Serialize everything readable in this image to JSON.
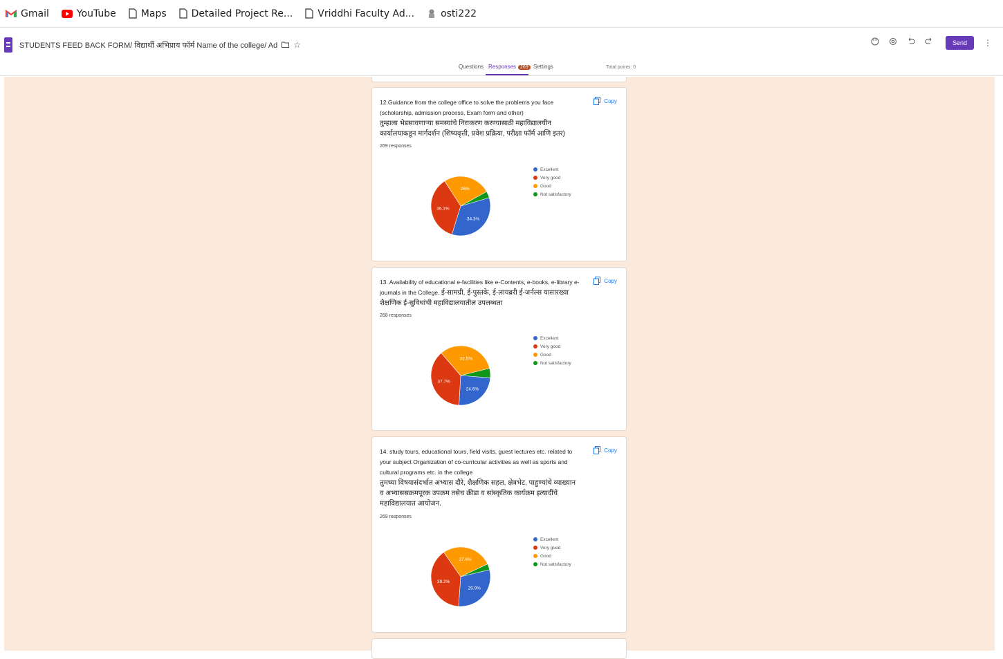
{
  "bookmarks": [
    {
      "label": "Gmail",
      "icon": "gmail-icon"
    },
    {
      "label": "YouTube",
      "icon": "youtube-icon"
    },
    {
      "label": "Maps",
      "icon": "page-icon"
    },
    {
      "label": "Detailed Project Re...",
      "icon": "page-icon"
    },
    {
      "label": "Vriddhi Faculty Ad...",
      "icon": "page-icon"
    },
    {
      "label": "osti222",
      "icon": "emblem-icon"
    }
  ],
  "header": {
    "title": "STUDENTS FEED BACK FORM/ विद्यार्थी अभिप्राय फॉर्म  Name of the college/ Ad",
    "send_label": "Send",
    "accent": "#673ab7"
  },
  "tabs": {
    "questions": "Questions",
    "responses": "Responses",
    "responses_count": "269",
    "settings": "Settings",
    "total_points": "Total points: 0"
  },
  "legend_labels": [
    "Excellent",
    "Very good",
    "Good",
    "Not satisfactory"
  ],
  "colors": {
    "excellent": "#3366cc",
    "very_good": "#dc3912",
    "good": "#ff9900",
    "not_satisfactory": "#109618",
    "background": "#fbe9dc"
  },
  "copy_label": "Copy",
  "questions": [
    {
      "title_en": "12.Guidance from the college office to solve the problems you face (scholarship, admission process, Exam form and other)",
      "title_mr": "तुम्हाला भेडसावणाऱ्या समस्यांचे निराकरण करण्यासाठी महाविद्यालयीन कार्यालयाकडून मार्गदर्शन (शिष्यवृत्ती, प्रवेश प्रक्रिया, परीक्षा फॉर्म आणि इतर)",
      "responses": "269 responses",
      "chart_data": {
        "type": "pie",
        "categories": [
          "Excellent",
          "Very good",
          "Good",
          "Not satisfactory"
        ],
        "values": [
          34.3,
          36.1,
          26,
          3.6
        ],
        "labels": [
          "34.3%",
          "36.1%",
          "26%",
          ""
        ]
      }
    },
    {
      "title_en": "13. Availability of educational e-facilities like e-Contents, e-books, e-library e-journals in the College.",
      "title_mr": "ई-सामग्री, ई-पुस्तके, ई-लायब्ररी ई-जर्नल्स यासारख्या शैक्षणिक ई-सुविधांची महाविद्यालयातील उपलब्धता",
      "responses": "268 responses",
      "chart_data": {
        "type": "pie",
        "categories": [
          "Excellent",
          "Very good",
          "Good",
          "Not satisfactory"
        ],
        "values": [
          24.6,
          37.7,
          32.5,
          5.2
        ],
        "labels": [
          "24.6%",
          "37.7%",
          "32.5%",
          ""
        ]
      }
    },
    {
      "title_en": "14. study tours, educational tours, field visits, guest lectures etc. related to your subject    Organization of co-curricular activities as well as sports and cultural programs etc. in the college",
      "title_mr": "तुमच्या विषयासंदर्भात अभ्यास दौरे, शैक्षणिक सहल, क्षेत्रभेट, पाहुण्यांचे व्याख्यान व अभ्याससक्रमपूरक उपक्रम तसेच क्रीडा व सांस्कृतिक कार्यक्रम इत्यादींचे महाविद्यालयात आयोजन.",
      "responses": "269 responses",
      "chart_data": {
        "type": "pie",
        "categories": [
          "Excellent",
          "Very good",
          "Good",
          "Not satisfactory"
        ],
        "values": [
          29.9,
          39.2,
          27.6,
          3.3
        ],
        "labels": [
          "29.9%",
          "39.2%",
          "27.6%",
          ""
        ]
      }
    }
  ]
}
